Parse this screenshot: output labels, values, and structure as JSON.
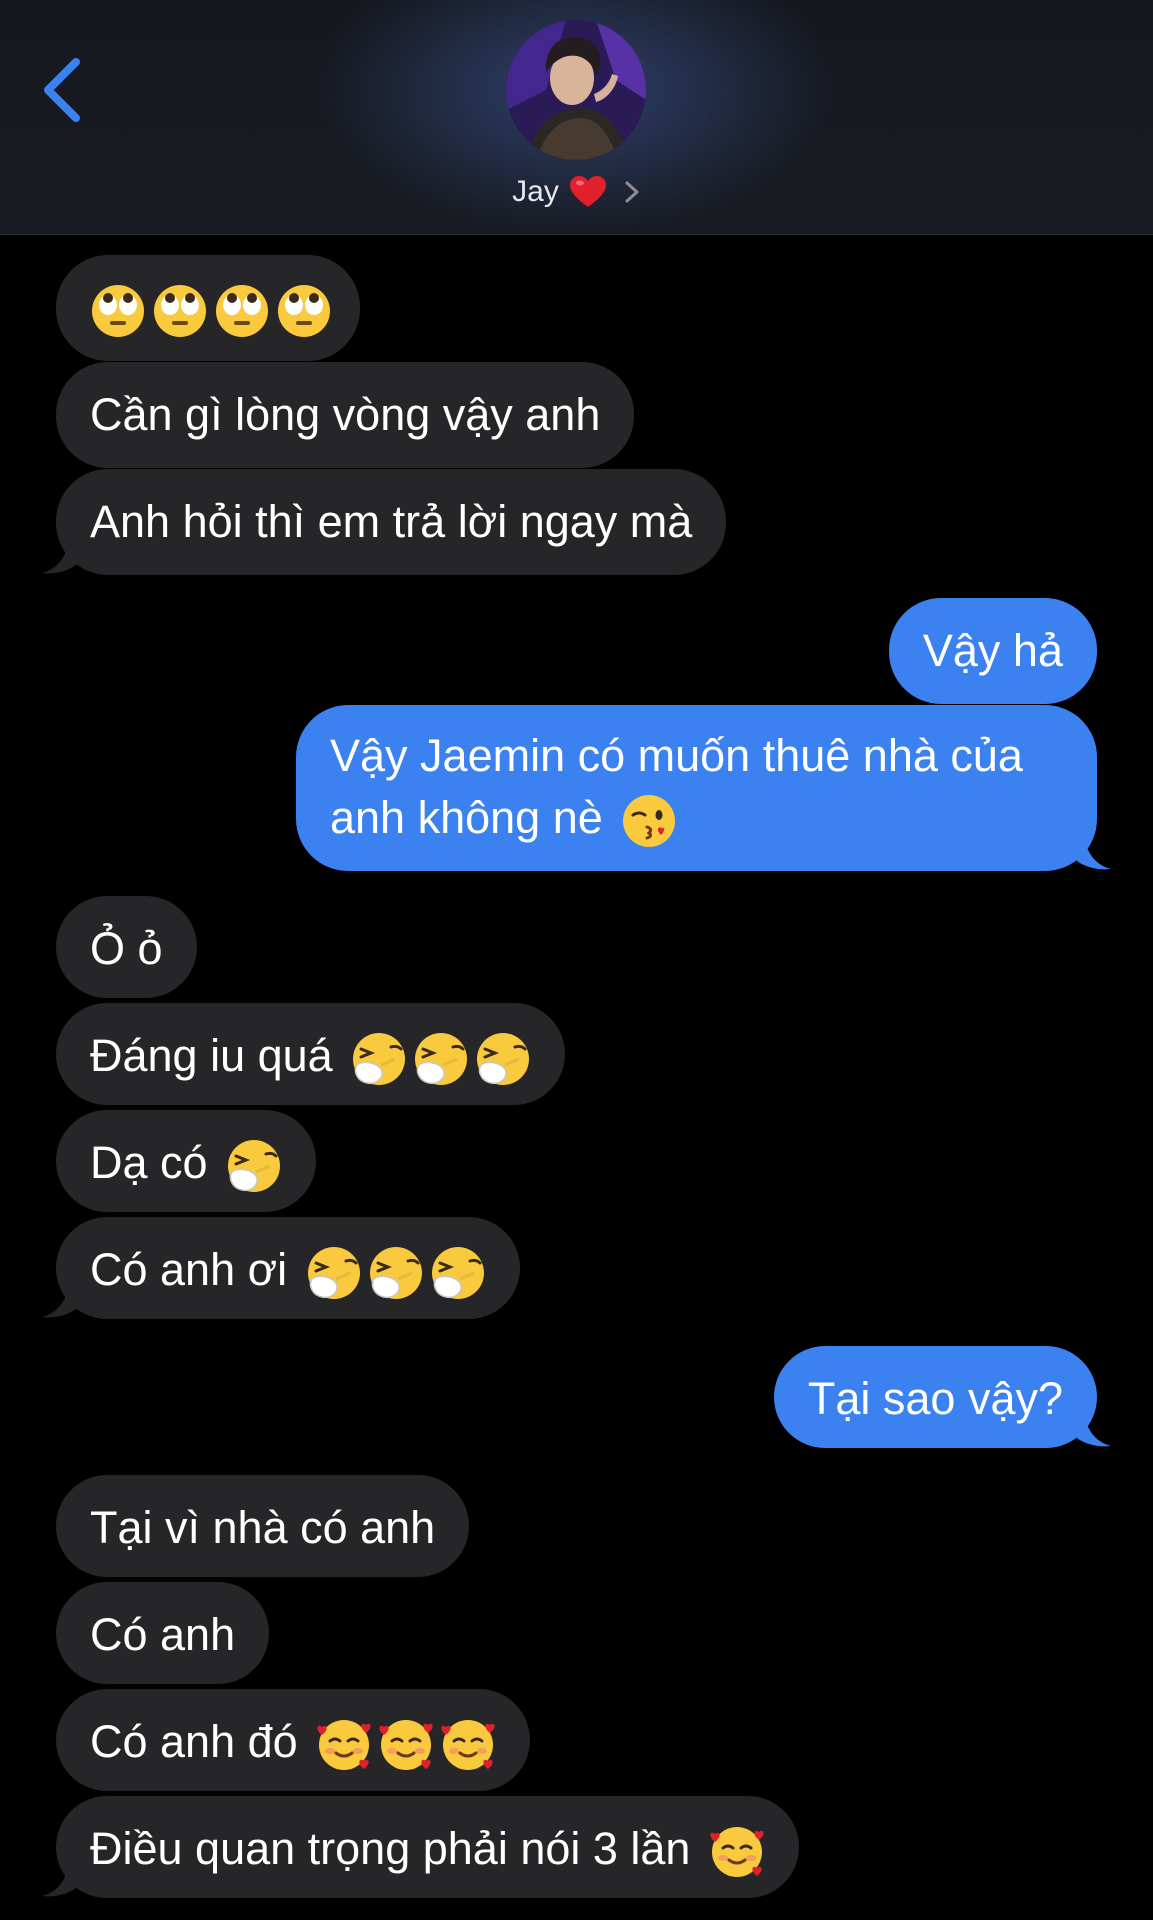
{
  "header": {
    "contact_name": "Jay",
    "colors": {
      "accent": "#3b82f0",
      "heart": "#e0202b"
    }
  },
  "messages": [
    {
      "dir": "in",
      "text": "",
      "emoji": [
        "eye-roll",
        "eye-roll",
        "eye-roll",
        "eye-roll"
      ]
    },
    {
      "dir": "in",
      "text": "Cần gì lòng vòng vậy anh"
    },
    {
      "dir": "in",
      "text": "Anh hỏi thì em trả lời ngay mà"
    },
    {
      "dir": "out",
      "text": "Vậy hả"
    },
    {
      "dir": "out",
      "text": "Vậy Jaemin có muốn thuê nhà của anh không nè",
      "emoji": [
        "kiss"
      ]
    },
    {
      "dir": "in",
      "text": "Ỏ ỏ"
    },
    {
      "dir": "in",
      "text": "Đáng iu quá",
      "emoji": [
        "sneeze",
        "sneeze",
        "sneeze"
      ]
    },
    {
      "dir": "in",
      "text": "Dạ có",
      "emoji": [
        "sneeze"
      ]
    },
    {
      "dir": "in",
      "text": "Có anh ơi",
      "emoji": [
        "sneeze",
        "sneeze",
        "sneeze"
      ]
    },
    {
      "dir": "out",
      "text": "Tại sao vậy?"
    },
    {
      "dir": "in",
      "text": "Tại vì nhà có anh"
    },
    {
      "dir": "in",
      "text": "Có anh"
    },
    {
      "dir": "in",
      "text": "Có anh đó",
      "emoji": [
        "hearts",
        "hearts",
        "hearts"
      ]
    },
    {
      "dir": "in",
      "text": "Điều quan trọng phải nói 3 lần",
      "emoji": [
        "hearts"
      ]
    }
  ]
}
